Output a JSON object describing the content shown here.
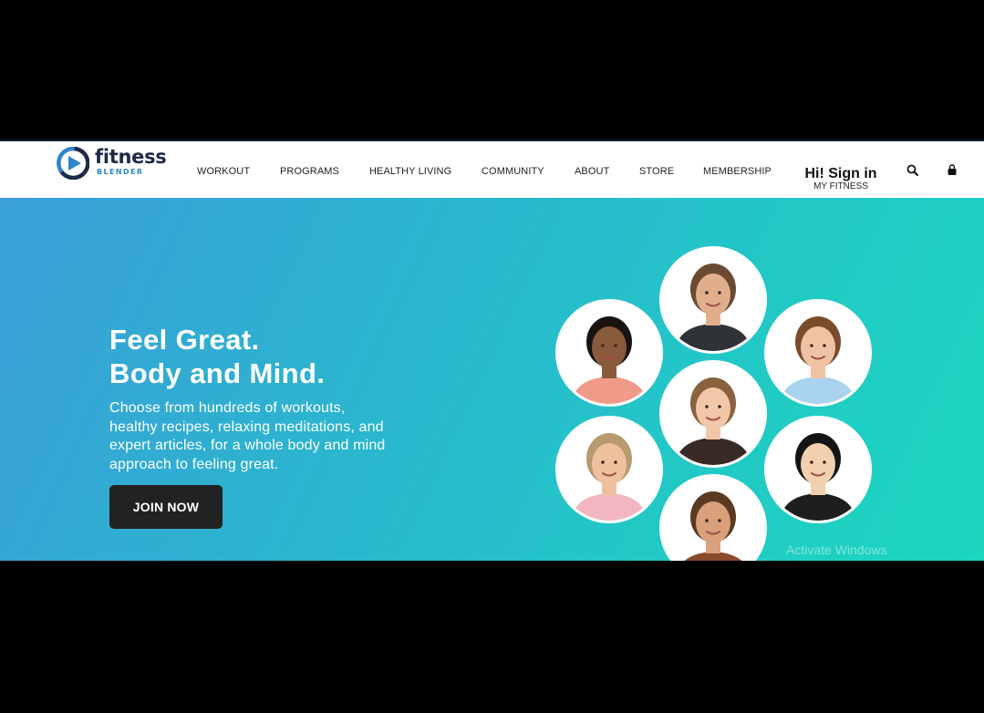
{
  "brand": {
    "name": "fitness",
    "subtitle": "BLENDER",
    "colors": {
      "navy": "#1c2a48",
      "blue": "#2f86c8"
    }
  },
  "nav": {
    "items": [
      {
        "label": "WORKOUT"
      },
      {
        "label": "PROGRAMS"
      },
      {
        "label": "HEALTHY LIVING"
      },
      {
        "label": "COMMUNITY"
      },
      {
        "label": "ABOUT"
      },
      {
        "label": "STORE"
      },
      {
        "label": "MEMBERSHIP"
      }
    ],
    "signin_label": "Hi! Sign in",
    "signin_sub": "MY FITNESS",
    "icons": [
      "search-icon",
      "shopping-bag-icon"
    ]
  },
  "hero": {
    "title_line1": "Feel Great.",
    "title_line2": "Body and Mind.",
    "description": "Choose from hundreds of workouts, healthy recipes, relaxing meditations, and expert articles, for a whole body and mind approach to feeling great.",
    "cta_label": "JOIN NOW",
    "gradient": [
      "#3b9fd8",
      "#1cd6bf"
    ],
    "trainers": [
      {
        "hair": "#1a1410",
        "skin": "#8a5a3c",
        "shirt": "#f09a8a"
      },
      {
        "hair": "#6b4a34",
        "skin": "#e0ae8c",
        "shirt": "#2f3338"
      },
      {
        "hair": "#7a4c2c",
        "skin": "#f0c2a4",
        "shirt": "#a9d3ee"
      },
      {
        "hair": "#8a6240",
        "skin": "#f2c6a8",
        "shirt": "#3a2a26"
      },
      {
        "hair": "#b79a6e",
        "skin": "#efc09e",
        "shirt": "#f2b6c0"
      },
      {
        "hair": "#141414",
        "skin": "#f2cfae",
        "shirt": "#1e1e1e"
      },
      {
        "hair": "#5a3a22",
        "skin": "#d9a07c",
        "shirt": "#8a4a2e"
      }
    ]
  },
  "system": {
    "watermark": "Activate Windows"
  }
}
